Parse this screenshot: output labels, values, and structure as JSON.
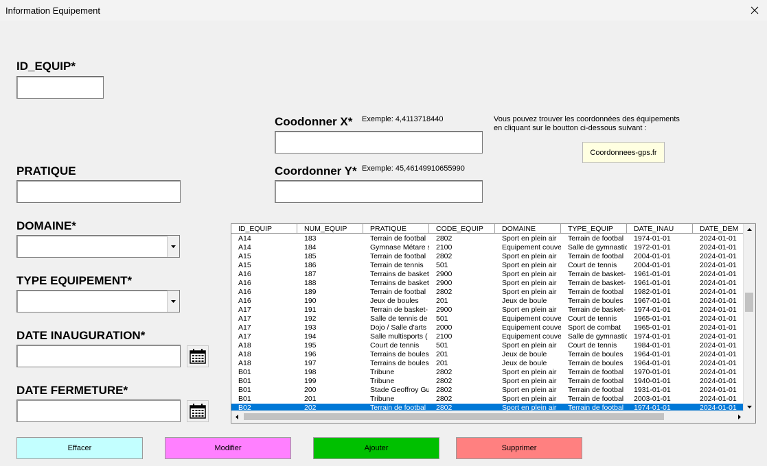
{
  "window": {
    "title": "Information Equipement"
  },
  "fields": {
    "id_equip": {
      "label": "ID_EQUIP*",
      "value": ""
    },
    "pratique": {
      "label": "PRATIQUE",
      "value": ""
    },
    "domaine": {
      "label": "DOMAINE*",
      "value": ""
    },
    "type_equipement": {
      "label": "TYPE EQUIPEMENT*",
      "value": ""
    },
    "date_inauguration": {
      "label": "DATE INAUGURATION*",
      "value": ""
    },
    "date_fermeture": {
      "label": "DATE FERMETURE*",
      "value": ""
    },
    "coord_x": {
      "label": "Coodonner X*",
      "example": "Exemple: 4,4113718440",
      "value": ""
    },
    "coord_y": {
      "label": "Coordonner Y*",
      "example": "Exemple: 45,46149910655990",
      "value": ""
    }
  },
  "gps": {
    "info_line1": "Vous pouvez trouver les coordonnées des équipements",
    "info_line2": "en cliquant sur le boutton ci-dessous suivant :",
    "button_label": "Coordonnees-gps.fr"
  },
  "table": {
    "columns": [
      "ID_EQUIP",
      "NUM_EQUIP",
      "PRATIQUE",
      "CODE_EQUIP",
      "DOMAINE",
      "TYPE_EQUIP",
      "DATE_INAU",
      "DATE_DEM"
    ],
    "rows": [
      [
        "A14",
        "183",
        "Terrain de footbal",
        "2802",
        "Sport en plein air",
        "Terrain de footbal",
        "1974-01-01",
        "2024-01-01"
      ],
      [
        "A14",
        "184",
        "Gymnase Métare s",
        "2100",
        "Equipement couve",
        "Salle de gymnastic",
        "1972-01-01",
        "2024-01-01"
      ],
      [
        "A15",
        "185",
        "Terrain de footbal",
        "2802",
        "Sport en plein air",
        "Terrain de footbal",
        "2004-01-01",
        "2024-01-01"
      ],
      [
        "A15",
        "186",
        "Terrain de tennis",
        "501",
        "Sport en plein air",
        "Court de tennis",
        "2004-01-01",
        "2024-01-01"
      ],
      [
        "A16",
        "187",
        "Terrains de basket",
        "2900",
        "Sport en plein air",
        "Terrain de basket-",
        "1961-01-01",
        "2024-01-01"
      ],
      [
        "A16",
        "188",
        "Terrains de basket",
        "2900",
        "Sport en plein air",
        "Terrain de basket-",
        "1961-01-01",
        "2024-01-01"
      ],
      [
        "A16",
        "189",
        "Terrain de footbal",
        "2802",
        "Sport en plein air",
        "Terrain de footbal",
        "1982-01-01",
        "2024-01-01"
      ],
      [
        "A16",
        "190",
        "Jeux de boules",
        "201",
        "Jeux de boule",
        "Terrain de boules",
        "1967-01-01",
        "2024-01-01"
      ],
      [
        "A17",
        "191",
        "Terrain de basket-",
        "2900",
        "Sport en plein air",
        "Terrain de basket-",
        "1974-01-01",
        "2024-01-01"
      ],
      [
        "A17",
        "192",
        "Salle de tennis de",
        "501",
        "Equipement couve",
        "Court de tennis",
        "1965-01-01",
        "2024-01-01"
      ],
      [
        "A17",
        "193",
        "Dojo / Salle d'arts",
        "2000",
        "Equipement couve",
        "Sport de combat",
        "1965-01-01",
        "2024-01-01"
      ],
      [
        "A17",
        "194",
        "Salle multisports (",
        "2100",
        "Equipement couve",
        "Salle de gymnastic",
        "1974-01-01",
        "2024-01-01"
      ],
      [
        "A18",
        "195",
        "Court de tennis",
        "501",
        "Sport en plein air",
        "Court de tennis",
        "1984-01-01",
        "2024-01-01"
      ],
      [
        "A18",
        "196",
        "Terrains de boules",
        "201",
        "Jeux de boule",
        "Terrain de boules",
        "1964-01-01",
        "2024-01-01"
      ],
      [
        "A18",
        "197",
        "Terrains de boules",
        "201",
        "Jeux de boule",
        "Terrain de boules",
        "1964-01-01",
        "2024-01-01"
      ],
      [
        "B01",
        "198",
        "Tribune",
        "2802",
        "Sport en plein air",
        "Terrain de footbal",
        "1970-01-01",
        "2024-01-01"
      ],
      [
        "B01",
        "199",
        "Tribune",
        "2802",
        "Sport en plein air",
        "Terrain de footbal",
        "1940-01-01",
        "2024-01-01"
      ],
      [
        "B01",
        "200",
        "Stade Geoffroy Gu",
        "2802",
        "Sport en plein air",
        "Terrain de footbal",
        "1931-01-01",
        "2024-01-01"
      ],
      [
        "B01",
        "201",
        "Tribune",
        "2802",
        "Sport en plein air",
        "Terrain de footbal",
        "2003-01-01",
        "2024-01-01"
      ],
      [
        "B02",
        "202",
        "Terrain de footbal",
        "2802",
        "Sport en plein air",
        "Terrain de footbal",
        "1974-01-01",
        "2024-01-01"
      ]
    ],
    "selected_row": 19
  },
  "buttons": {
    "effacer": {
      "label": "Effacer",
      "color": "#c3ffff"
    },
    "modifier": {
      "label": "Modifier",
      "color": "#ff80ff"
    },
    "ajouter": {
      "label": "Ajouter",
      "color": "#00c000"
    },
    "supprimer": {
      "label": "Supprimer",
      "color": "#ff8080"
    }
  },
  "icons": {
    "close": "close-icon",
    "calendar": "calendar-icon",
    "dropdown": "chevron-down-icon"
  },
  "colors": {
    "selection": "#0078d7",
    "window_bg": "#f0f0f0"
  }
}
